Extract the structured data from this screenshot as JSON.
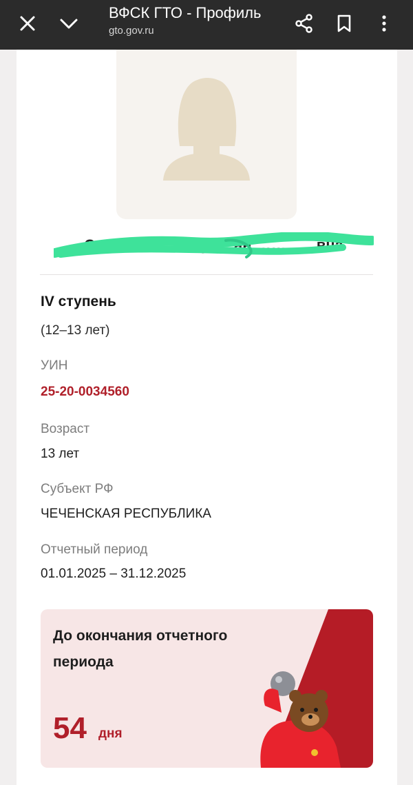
{
  "browser": {
    "title": "ВФСК ГТО - Профиль",
    "url": "gto.gov.ru",
    "icons": [
      "close-icon",
      "chevron-down-icon",
      "share-icon",
      "bookmark-icon",
      "more-vertical-icon"
    ]
  },
  "profile": {
    "name": "С……………… Сул…ан …………вна",
    "level": "IV ступень",
    "age_range": "(12–13 лет)",
    "uin_label": "УИН",
    "uin": "25-20-0034560",
    "age_label": "Возраст",
    "age": "13 лет",
    "region_label": "Субъект РФ",
    "region": "ЧЕЧЕНСКАЯ РЕСПУБЛИКА",
    "period_label": "Отчетный период",
    "period": "01.01.2025 – 31.12.2025"
  },
  "countdown": {
    "text": "До окончания отчетного периода",
    "days": "54",
    "unit": "дня"
  },
  "colors": {
    "accent_red": "#b0202a",
    "topbar": "#2b2b2b",
    "banner_bg": "#f7e6e6",
    "scribble": "#3ee29a"
  }
}
